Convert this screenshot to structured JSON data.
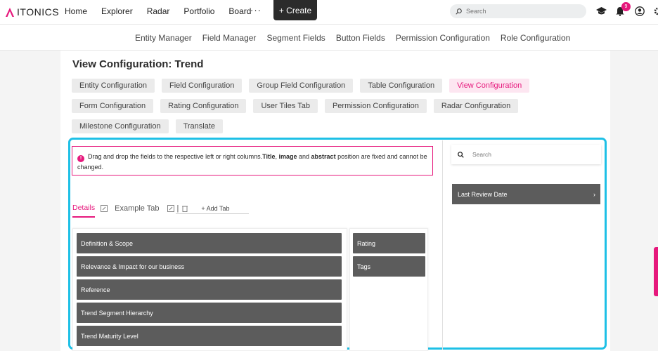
{
  "brand": {
    "logo_text": "ITONICS",
    "accent": "#e6187c",
    "highlight": "#1ec0e6"
  },
  "topnav": {
    "items": [
      "Home",
      "Explorer",
      "Radar",
      "Portfolio",
      "Board"
    ],
    "more": "···",
    "create_label": "+ Create",
    "search_placeholder": "Search",
    "notification_count": "9",
    "icons": [
      "graduation-cap-icon",
      "bell-icon",
      "user-icon",
      "settings-icon"
    ]
  },
  "subnav": {
    "items": [
      "Entity Manager",
      "Field Manager",
      "Segment Fields",
      "Button Fields",
      "Permission Configuration",
      "Role Configuration"
    ]
  },
  "page": {
    "title": "View Configuration: Trend",
    "config_tabs": [
      [
        "Entity Configuration",
        "Field Configuration",
        "Group Field Configuration",
        "Table Configuration",
        "View Configuration"
      ],
      [
        "Form Configuration",
        "Rating Configuration",
        "User Tiles Tab",
        "Permission Configuration",
        "Radar Configuration"
      ],
      [
        "Milestone Configuration",
        "Translate"
      ]
    ],
    "active_tab": "View Configuration"
  },
  "info": {
    "text_1": "Drag and drop the fields to the respective left or right columns.",
    "bold_1": "Title",
    "sep_1": ", ",
    "bold_2": "image",
    "text_2": " and ",
    "bold_3": "abstract",
    "text_3": " position are fixed and cannot be changed."
  },
  "detail_tabs": {
    "active": "Details",
    "other": "Example Tab",
    "add_label": "+ Add Tab"
  },
  "left_fields": [
    "Definition & Scope",
    "Relevance & Impact for our business",
    "Reference",
    "Trend Segment Hierarchy",
    "Trend Maturity Level"
  ],
  "right_fields": [
    "Rating",
    "Tags"
  ],
  "side": {
    "search_placeholder": "Search",
    "fields": [
      "Last Review Date"
    ],
    "chevron": "›"
  }
}
